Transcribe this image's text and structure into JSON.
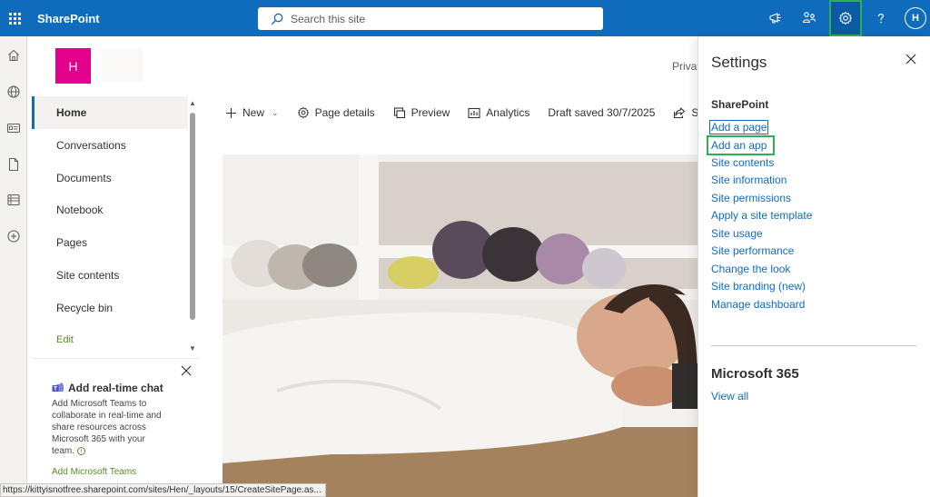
{
  "suite_bar": {
    "app_name": "SharePoint",
    "search_placeholder": "Search this site",
    "avatar_initial": "H"
  },
  "site_header": {
    "logo_initial": "H",
    "privacy_text": "Privat"
  },
  "left_nav": {
    "items": [
      {
        "label": "Home",
        "selected": true
      },
      {
        "label": "Conversations"
      },
      {
        "label": "Documents"
      },
      {
        "label": "Notebook"
      },
      {
        "label": "Pages"
      },
      {
        "label": "Site contents"
      },
      {
        "label": "Recycle bin"
      }
    ],
    "edit_label": "Edit"
  },
  "teams_promo": {
    "title": "Add real-time chat",
    "body": "Add Microsoft Teams to collaborate in real-time and share resources across Microsoft 365 with your team.",
    "link": "Add Microsoft Teams"
  },
  "command_bar": {
    "new_label": "New",
    "page_details_label": "Page details",
    "preview_label": "Preview",
    "analytics_label": "Analytics",
    "draft_status": "Draft saved 30/7/2025",
    "share_label": "Sha"
  },
  "settings_panel": {
    "title": "Settings",
    "section_sharepoint": "SharePoint",
    "links": [
      "Add a page",
      "Add an app",
      "Site contents",
      "Site information",
      "Site permissions",
      "Apply a site template",
      "Site usage",
      "Site performance",
      "Change the look",
      "Site branding (new)",
      "Manage dashboard"
    ],
    "section_m365": "Microsoft 365",
    "view_all": "View all"
  },
  "status_bar": {
    "url": "https://kittyisnotfree.sharepoint.com/sites/Hen/_layouts/15/CreateSitePage.as..."
  },
  "colors": {
    "suite_bar": "#0f6cbd",
    "site_logo": "#e3008c",
    "link": "#0f6cbd",
    "highlight": "#2db14e",
    "teams_link": "#5c8a23"
  }
}
